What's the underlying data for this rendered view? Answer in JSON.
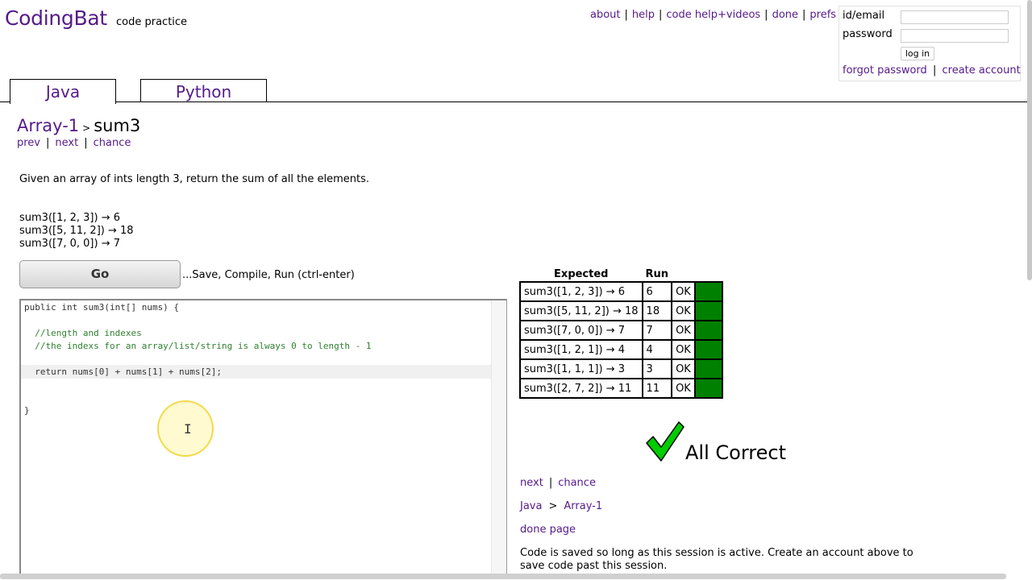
{
  "header": {
    "logo": "CodingBat",
    "tagline": "code practice",
    "nav": [
      "about",
      "help",
      "code help+videos",
      "done",
      "prefs"
    ]
  },
  "login": {
    "id_label": "id/email",
    "password_label": "password",
    "login_button": "log in",
    "forgot": "forgot password",
    "create": "create account"
  },
  "tabs": [
    "Java",
    "Python"
  ],
  "problem": {
    "section": "Array-1",
    "name": "sum3",
    "nav": {
      "prev": "prev",
      "next": "next",
      "chance": "chance"
    },
    "description": "Given an array of ints length 3, return the sum of all the elements.",
    "examples": [
      "sum3([1, 2, 3]) → 6",
      "sum3([5, 11, 2]) → 18",
      "sum3([7, 0, 0]) → 7"
    ]
  },
  "go": {
    "label": "Go",
    "hint": "...Save, Compile, Run (ctrl-enter)"
  },
  "editor": {
    "lines": [
      "public int sum3(int[] nums) {",
      "",
      "  //length and indexes",
      "  //the indexs for an array/list/string is always 0 to length - 1",
      "",
      "  return nums[0] + nums[1] + nums[2];",
      "",
      "",
      "}"
    ]
  },
  "results": {
    "headers": [
      "Expected",
      "Run"
    ],
    "rows": [
      {
        "expected": "sum3([1, 2, 3]) → 6",
        "run": "6",
        "status": "OK"
      },
      {
        "expected": "sum3([5, 11, 2]) → 18",
        "run": "18",
        "status": "OK"
      },
      {
        "expected": "sum3([7, 0, 0]) → 7",
        "run": "7",
        "status": "OK"
      },
      {
        "expected": "sum3([1, 2, 1]) → 4",
        "run": "4",
        "status": "OK"
      },
      {
        "expected": "sum3([1, 1, 1]) → 3",
        "run": "3",
        "status": "OK"
      },
      {
        "expected": "sum3([2, 7, 2]) → 11",
        "run": "11",
        "status": "OK"
      }
    ],
    "pass_color": "#008000"
  },
  "verdict": {
    "text": "All Correct",
    "icon": "check-icon"
  },
  "after": {
    "next": "next",
    "chance": "chance",
    "crumb_lang": "Java",
    "crumb_section": "Array-1",
    "done_page": "done page",
    "save_note": "Code is saved so long as this session is active. Create an account above to save code past this session."
  },
  "colors": {
    "link": "#551a8b",
    "pass": "#008000",
    "check": "#00cc00"
  }
}
